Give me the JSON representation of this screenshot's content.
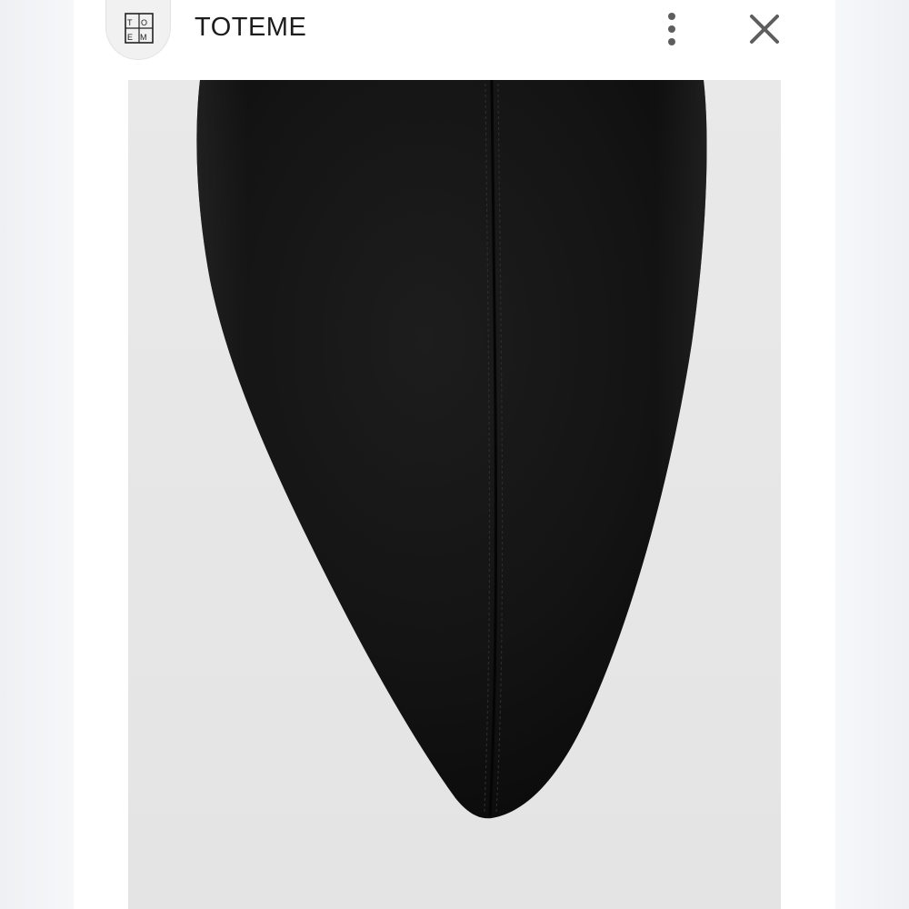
{
  "header": {
    "brand_name": "TOTEME",
    "logo_icon": "toteme-monogram-logo",
    "more_icon": "more-vertical-icon",
    "close_icon": "close-icon"
  },
  "photo": {
    "subject": "black-suede-pointed-boot-toe",
    "background_color": "#e6e6e6",
    "product_color": "#141414"
  }
}
